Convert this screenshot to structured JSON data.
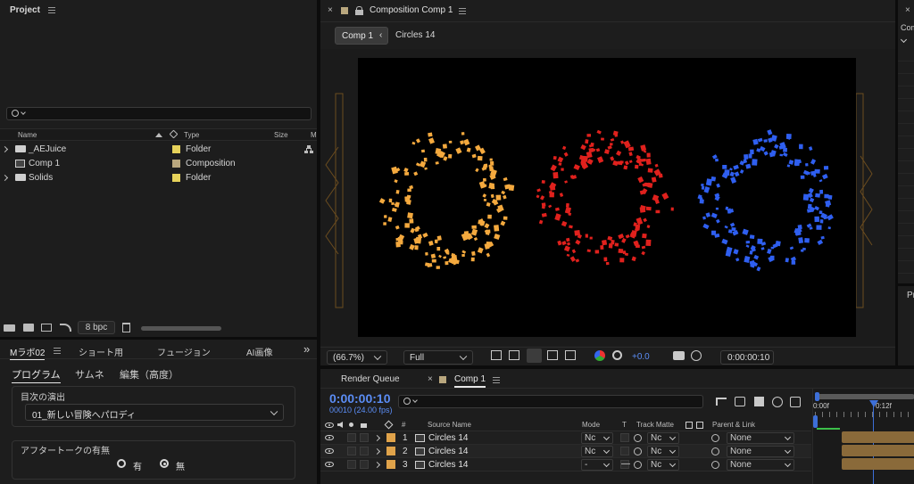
{
  "project": {
    "title": "Project",
    "columns": {
      "name": "Name",
      "type": "Type",
      "size": "Size",
      "m": "M"
    },
    "items": [
      {
        "name": "_AEJuice",
        "type": "Folder",
        "color": "#e6d25a",
        "kind": "folder"
      },
      {
        "name": "Comp 1",
        "type": "Composition",
        "color": "#b9a77e",
        "kind": "comp"
      },
      {
        "name": "Solids",
        "type": "Folder",
        "color": "#e6d25a",
        "kind": "folder"
      }
    ],
    "bpc": "8 bpc"
  },
  "mlab": {
    "tabs": [
      "Mラボ02",
      "ショート用",
      "フュージョン",
      "AI画像"
    ],
    "subtabs": [
      "プログラム",
      "サムネ",
      "編集（高度）"
    ],
    "section1": {
      "title": "目次の演出",
      "value": "01_新しい冒険へパロディ"
    },
    "section2": {
      "title": "アフタートークの有無",
      "opt_yes": "有",
      "opt_no": "無",
      "selected": "無"
    }
  },
  "comp_viewer": {
    "title": "Composition Comp 1",
    "breadcrumb": [
      "Comp 1",
      "Circles 14"
    ],
    "zoom": "(66.7%)",
    "resolution": "Full",
    "exposure": "+0.0",
    "timecode": "0:00:00:10",
    "rings": [
      {
        "color": "#f4a93e",
        "name": "orange"
      },
      {
        "color": "#e0211d",
        "name": "red"
      },
      {
        "color": "#2f5ff0",
        "name": "blue"
      }
    ]
  },
  "right_panel": {
    "label_top": "Com",
    "label_bottom": "Pr"
  },
  "timeline": {
    "tabs": {
      "render_queue": "Render Queue",
      "comp": "Comp 1"
    },
    "timecode": "0:00:00:10",
    "frame_info": "00010 (24.00 fps)",
    "columns": {
      "num": "#",
      "source": "Source Name",
      "mode": "Mode",
      "t": "T",
      "track_matte": "Track Matte",
      "parent": "Parent & Link"
    },
    "layers": [
      {
        "num": "1",
        "name": "Circles 14",
        "mode": "Nc",
        "t": "",
        "matte": "Nc",
        "parent": "None"
      },
      {
        "num": "2",
        "name": "Circles 14",
        "mode": "Nc",
        "t": "",
        "matte": "Nc",
        "parent": "None"
      },
      {
        "num": "3",
        "name": "Circles 14",
        "mode": "-",
        "t": "—",
        "matte": "Nc",
        "parent": "None"
      }
    ],
    "ruler": {
      "start": "0:00f",
      "mark": "0:12f"
    },
    "label_color": "#e0a34a",
    "bar_color": "#8a6a3a"
  }
}
